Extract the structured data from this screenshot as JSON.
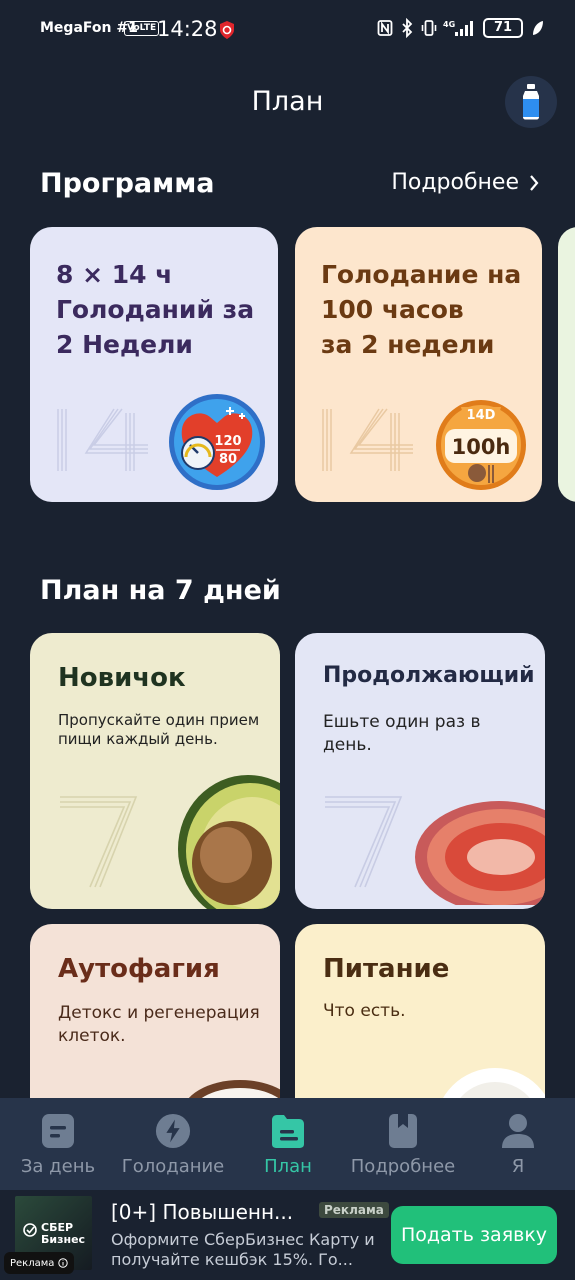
{
  "status_bar": {
    "carrier": "MegaFon #1",
    "volte": "VoLTE",
    "time": "14:28",
    "battery": "71"
  },
  "header": {
    "title": "План",
    "bottle_icon": "water-bottle-icon"
  },
  "program": {
    "title": "Программа",
    "more_label": "Подробнее",
    "cards": [
      {
        "title": "8 × 14 ч\nГолоданий за\n2 Недели",
        "number": "14",
        "gauge_top": "120",
        "gauge_bottom": "80",
        "bg": "#e4e6f7",
        "title_color": "#3b2a5e"
      },
      {
        "title": "Голодание на\n100 часов\nза 2 недели",
        "number": "14",
        "badge_top": "14D",
        "badge_main": "100h",
        "bg": "#fde6cd",
        "title_color": "#6b3a12"
      }
    ]
  },
  "plans": {
    "title": "План на 7 дней",
    "cards": [
      {
        "name": "Новичок",
        "desc": "Пропускайте один прием пищи каждый день.",
        "number": "7",
        "bg": "#eeebcf",
        "name_color": "#1f3320"
      },
      {
        "name": "Продолжающий",
        "desc": "Ешьте один раз в день.",
        "number": "7",
        "bg": "#e3e6f5",
        "name_color": "#232a44"
      },
      {
        "name": "Аутофагия",
        "desc": "Детокс и регенерация клеток.",
        "bg": "#f4e2d7",
        "name_color": "#6a2d1a"
      },
      {
        "name": "Питание",
        "desc": "Что есть.",
        "bg": "#fbefcb",
        "name_color": "#4a2d12"
      }
    ]
  },
  "bottom_nav": {
    "items": [
      {
        "label": "За день",
        "icon": "daily-log-icon"
      },
      {
        "label": "Голодание",
        "icon": "lightning-icon"
      },
      {
        "label": "План",
        "icon": "plan-folder-icon"
      },
      {
        "label": "Подробнее",
        "icon": "bookmark-book-icon"
      },
      {
        "label": "Я",
        "icon": "profile-icon"
      }
    ]
  },
  "ad": {
    "logo_text": "СБЕР\nБизнес",
    "headline": "[0+] Повышенн...",
    "badge": "Реклама",
    "body": "Оформите СберБизнес Карту и получайте кешбэк 15%. Го...",
    "cta": "Подать заявку",
    "label": "Реклама"
  },
  "colors": {
    "background": "#1a2230",
    "nav_active": "#35c6a6",
    "cta": "#21c07a"
  }
}
